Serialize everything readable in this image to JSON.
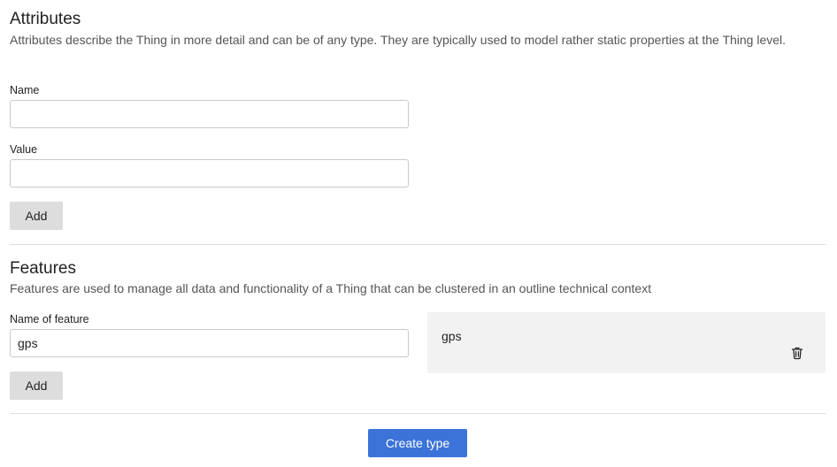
{
  "attributes": {
    "title": "Attributes",
    "description": "Attributes describe the Thing in more detail and can be of any type. They are typically used to model rather static properties at the Thing level.",
    "name_label": "Name",
    "name_value": "",
    "value_label": "Value",
    "value_value": "",
    "add_label": "Add"
  },
  "features": {
    "title": "Features",
    "description": "Features are used to manage all data and functionality of a Thing that can be clustered in an outline technical context",
    "name_label": "Name of feature",
    "name_value": "gps",
    "add_label": "Add",
    "items": [
      {
        "name": "gps",
        "icon": "trash-icon"
      }
    ]
  },
  "footer": {
    "create_label": "Create type"
  },
  "colors": {
    "primary": "#3b73d9",
    "secondary_button": "#dddddd",
    "card_bg": "#f1f2f1",
    "divider": "#dcdcdc"
  }
}
